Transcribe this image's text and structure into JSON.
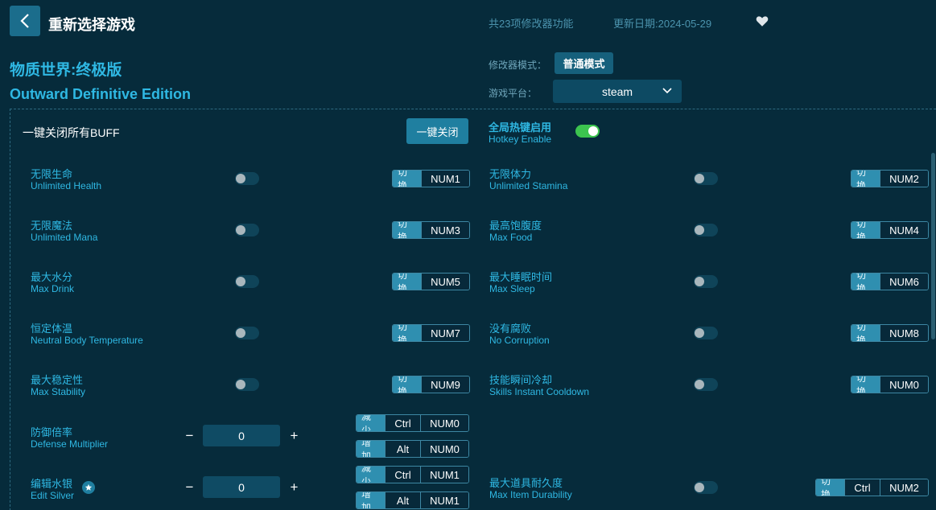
{
  "header": {
    "title": "重新选择游戏",
    "feature_count": "共23项修改器功能",
    "update_date": "更新日期:2024-05-29"
  },
  "game": {
    "name_cn": "物质世界:终极版",
    "name_en": "Outward Definitive Edition"
  },
  "mode": {
    "label": "修改器模式：",
    "value": "普通模式"
  },
  "platform": {
    "label": "游戏平台：",
    "value": "steam"
  },
  "buff": {
    "label": "一键关闭所有BUFF",
    "button": "一键关闭"
  },
  "hotkey": {
    "label_cn": "全局热键启用",
    "label_en": "Hotkey Enable",
    "enabled": true
  },
  "options": [
    {
      "cn": "无限生命",
      "en": "Unlimited Health",
      "tag": "切换",
      "keys": [
        "NUM1"
      ],
      "on": false
    },
    {
      "cn": "无限体力",
      "en": "Unlimited Stamina",
      "tag": "切换",
      "keys": [
        "NUM2"
      ],
      "on": false
    },
    {
      "cn": "无限魔法",
      "en": "Unlimited Mana",
      "tag": "切换",
      "keys": [
        "NUM3"
      ],
      "on": false
    },
    {
      "cn": "最高饱腹度",
      "en": "Max Food",
      "tag": "切换",
      "keys": [
        "NUM4"
      ],
      "on": false
    },
    {
      "cn": "最大水分",
      "en": "Max Drink",
      "tag": "切换",
      "keys": [
        "NUM5"
      ],
      "on": false
    },
    {
      "cn": "最大睡眠时间",
      "en": "Max Sleep",
      "tag": "切换",
      "keys": [
        "NUM6"
      ],
      "on": false
    },
    {
      "cn": "恒定体温",
      "en": "Neutral Body Temperature",
      "tag": "切换",
      "keys": [
        "NUM7"
      ],
      "on": false
    },
    {
      "cn": "没有腐败",
      "en": "No Corruption",
      "tag": "切换",
      "keys": [
        "NUM8"
      ],
      "on": false
    },
    {
      "cn": "最大稳定性",
      "en": "Max Stability",
      "tag": "切换",
      "keys": [
        "NUM9"
      ],
      "on": false
    },
    {
      "cn": "技能瞬间冷却",
      "en": "Skills Instant Cooldown",
      "tag": "切换",
      "keys": [
        "NUM0"
      ],
      "on": false
    },
    {
      "cn": "最大道具耐久度",
      "en": "Max Item Durability",
      "tag": "切换",
      "keys": [
        "Ctrl",
        "NUM2"
      ],
      "on": false
    }
  ],
  "numeric_options": [
    {
      "cn": "防御倍率",
      "en": "Defense Multiplier",
      "value": "0",
      "minus": "−",
      "plus": "+",
      "dec": {
        "tag": "减少",
        "keys": [
          "Ctrl",
          "NUM0"
        ]
      },
      "inc": {
        "tag": "增加",
        "keys": [
          "Alt",
          "NUM0"
        ]
      }
    },
    {
      "cn": "编辑水银",
      "en": "Edit Silver",
      "value": "0",
      "minus": "−",
      "plus": "+",
      "dec": {
        "tag": "减少",
        "keys": [
          "Ctrl",
          "NUM1"
        ]
      },
      "inc": {
        "tag": "增加",
        "keys": [
          "Alt",
          "NUM1"
        ]
      }
    }
  ],
  "icons": {
    "back": "chevron-left-icon",
    "favorite": "heart-icon",
    "dropdown": "chevron-down-icon",
    "star": "star-icon"
  },
  "colors": {
    "accent": "#2fb8e3",
    "background": "#062b3b",
    "toggle_on": "#3cc44f",
    "tag_bg": "#2f8fb0"
  }
}
